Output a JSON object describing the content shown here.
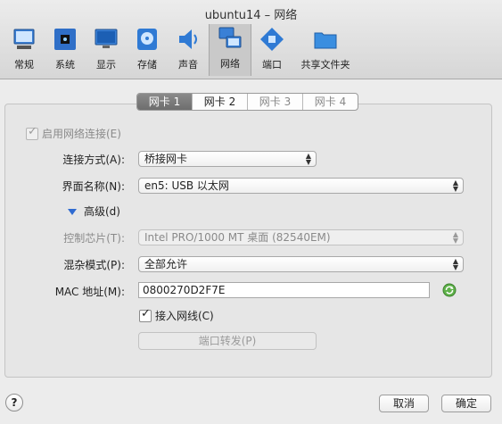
{
  "window": {
    "title": "ubuntu14 – 网络"
  },
  "toolbar": {
    "items": [
      {
        "label": "常规",
        "icon": "general-monitor-icon"
      },
      {
        "label": "系统",
        "icon": "chip-icon"
      },
      {
        "label": "显示",
        "icon": "display-icon"
      },
      {
        "label": "存储",
        "icon": "disk-icon"
      },
      {
        "label": "声音",
        "icon": "speaker-icon"
      },
      {
        "label": "网络",
        "icon": "network-icon",
        "selected": true
      },
      {
        "label": "端口",
        "icon": "port-icon"
      },
      {
        "label": "共享文件夹",
        "icon": "folder-icon"
      }
    ]
  },
  "tabs": [
    {
      "label": "网卡 1",
      "state": "active"
    },
    {
      "label": "网卡 2",
      "state": "enabled"
    },
    {
      "label": "网卡 3",
      "state": "disabled"
    },
    {
      "label": "网卡 4",
      "state": "disabled"
    }
  ],
  "form": {
    "enable_label": "启用网络连接(E)",
    "attach_label": "连接方式(A):",
    "attach_value": "桥接网卡",
    "name_label": "界面名称(N):",
    "name_value": "en5: USB 以太网",
    "advanced_label": "高级(d)",
    "adapter_label": "控制芯片(T):",
    "adapter_value": "Intel PRO/1000 MT 桌面 (82540EM)",
    "promisc_label": "混杂模式(P):",
    "promisc_value": "全部允许",
    "mac_label": "MAC 地址(M):",
    "mac_value": "0800270D2F7E",
    "cable_label": "接入网线(C)",
    "portfwd_label": "端口转发(P)"
  },
  "footer": {
    "help": "?",
    "cancel": "取消",
    "ok": "确定"
  }
}
